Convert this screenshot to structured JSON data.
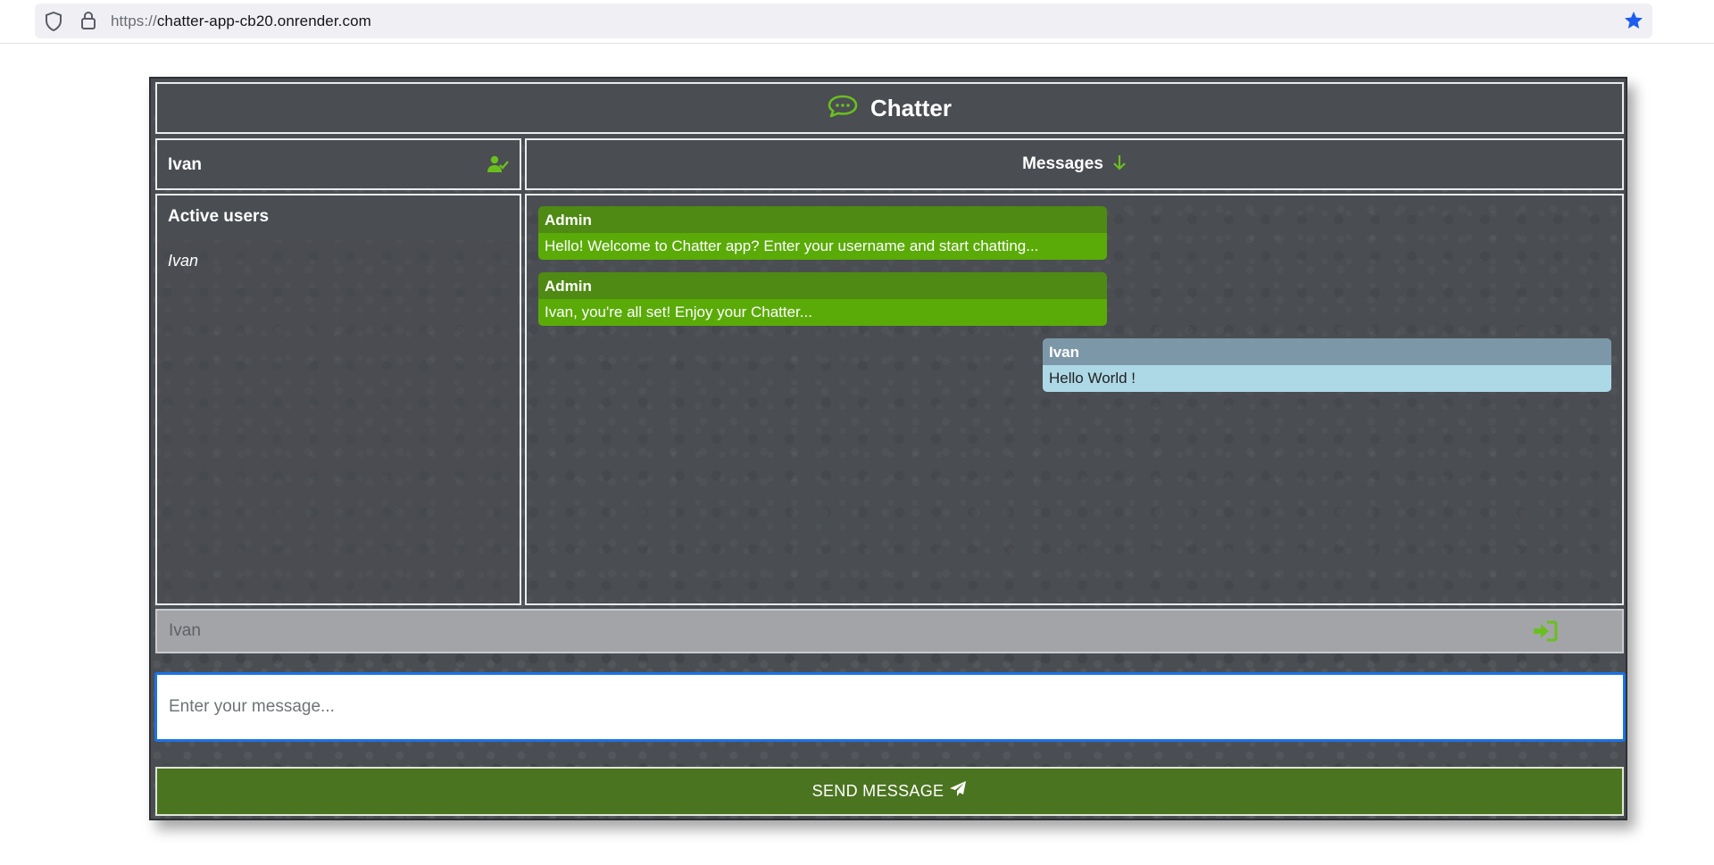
{
  "browser": {
    "url_scheme": "https://",
    "url_host": "chatter-app-cb20.onrender.com"
  },
  "app": {
    "title": "Chatter",
    "current_user": "Ivan",
    "messages_header": "Messages",
    "active_users_title": "Active users",
    "active_users": [
      "Ivan"
    ],
    "messages": [
      {
        "sender": "Admin",
        "text": "Hello! Welcome to Chatter app? Enter your username and start chatting...",
        "type": "admin"
      },
      {
        "sender": "Admin",
        "text": "Ivan, you're all set! Enjoy your Chatter...",
        "type": "admin"
      },
      {
        "sender": "Ivan",
        "text": "Hello World !",
        "type": "user"
      }
    ],
    "username_input_placeholder": "Ivan",
    "message_input_placeholder": "Enter your message...",
    "send_button_label": "SEND MESSAGE"
  },
  "colors": {
    "accent_green": "#6abf1f",
    "admin_bubble": "#5aab08",
    "user_bubble": "#add8e6",
    "send_button": "#4b7420",
    "focus_border": "#1a73e8"
  },
  "icons": {
    "chat": "chat-bubble-icon",
    "user_check": "user-check-icon",
    "arrow_down": "arrow-down-icon",
    "login": "sign-in-icon",
    "send": "paper-plane-icon",
    "shield": "shield-icon",
    "lock": "lock-icon",
    "bookmark": "star-icon"
  }
}
